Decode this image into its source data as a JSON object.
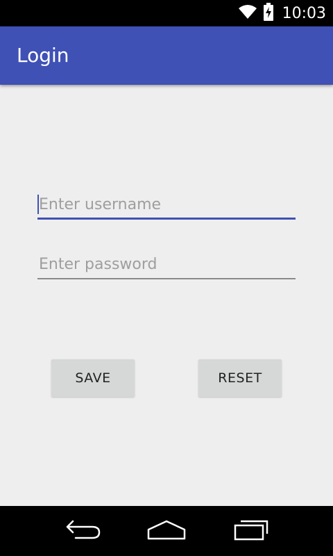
{
  "status_bar": {
    "time": "10:03",
    "icons": [
      "wifi-icon",
      "battery-charging-icon"
    ]
  },
  "app_bar": {
    "title": "Login",
    "color": "#3f51b5"
  },
  "form": {
    "username": {
      "placeholder": "Enter username",
      "value": "",
      "focused": true
    },
    "password": {
      "placeholder": "Enter password",
      "value": ""
    },
    "save_label": "SAVE",
    "reset_label": "RESET"
  },
  "nav_bar": {
    "icons": [
      "back-icon",
      "home-icon",
      "recents-icon"
    ]
  },
  "colors": {
    "accent": "#3f51b5",
    "background": "#eeeeee",
    "button": "#d6d7d7"
  }
}
